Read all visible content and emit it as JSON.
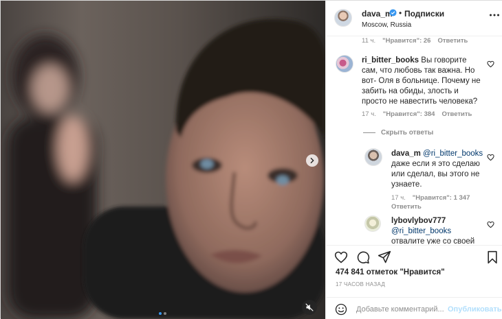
{
  "post": {
    "owner": {
      "username": "dava_m",
      "verified": true,
      "follow_label": "Подписки",
      "location": "Moscow, Russia"
    },
    "first_meta": {
      "time": "11 ч.",
      "likes": "\"Нравится\": 26",
      "reply_label": "Ответить"
    },
    "comments": [
      {
        "username": "ri_bitter_books",
        "text": "Вы говорите сам, что любовь так важна. Но вот- Оля в больнице. Почему не забить на обиды, злость и просто не навестить человека?",
        "time": "17 ч.",
        "likes": "\"Нравится\": 384",
        "reply_label": "Ответить"
      }
    ],
    "hide_replies_label": "Скрыть ответы",
    "replies": [
      {
        "username": "dava_m",
        "mention": "@ri_bitter_books",
        "text": "даже если я это сделаю или сделал, вы этого не узнаете.",
        "time": "17 ч.",
        "likes": "\"Нравится\": 1 347",
        "reply_label": "Ответить"
      },
      {
        "username": "lybovlybov777",
        "mention": "@ri_bitter_books",
        "text": "отвалите уже со своей"
      }
    ],
    "likes_text": "474 841 отметок \"Нравится\"",
    "posted_ago": "17 ЧАСОВ НАЗАД",
    "add_comment": {
      "placeholder": "Добавьте комментарий...",
      "publish_label": "Опубликовать"
    },
    "carousel": {
      "slides": 2,
      "active": 1
    },
    "icons": {
      "verified": "verified-badge-icon",
      "more": "more-options-icon",
      "like": "heart-icon",
      "comment": "comment-icon",
      "share": "share-icon",
      "save": "bookmark-icon",
      "emoji": "emoji-icon",
      "next": "chevron-right-icon",
      "mute": "sound-off-icon"
    },
    "colors": {
      "accent": "#3897f0",
      "publish_disabled": "#b2dffc",
      "secondary_text": "#8e8e8e"
    }
  }
}
